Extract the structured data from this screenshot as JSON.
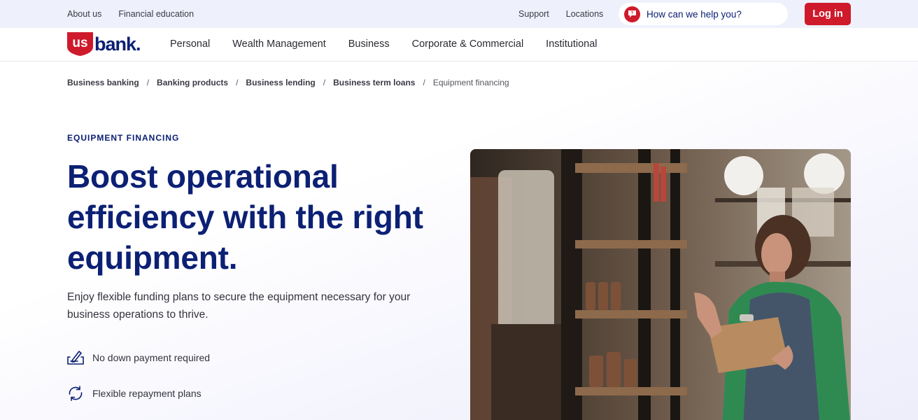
{
  "utility": {
    "left_links": [
      "About us",
      "Financial education"
    ],
    "right_links": [
      "Support",
      "Locations"
    ],
    "help_text": "How can we help you?",
    "login_label": "Log in"
  },
  "brand": {
    "logo_us": "us",
    "logo_bank": "bank.",
    "accent_red": "#cf1a2b",
    "navy": "#0c2074"
  },
  "nav": {
    "items": [
      "Personal",
      "Wealth Management",
      "Business",
      "Corporate & Commercial",
      "Institutional"
    ]
  },
  "breadcrumb": {
    "links": [
      "Business banking",
      "Banking products",
      "Business lending",
      "Business term loans"
    ],
    "separator": "/",
    "current": "Equipment financing"
  },
  "hero": {
    "eyebrow": "EQUIPMENT FINANCING",
    "headline": "Boost operational efficiency with the right equipment.",
    "subtext": "Enjoy flexible funding plans to secure the equipment necessary for your business operations to thrive.",
    "features": [
      {
        "icon": "signing-document-icon",
        "label": "No down payment required"
      },
      {
        "icon": "refresh-cycle-icon",
        "label": "Flexible repayment plans"
      }
    ]
  }
}
